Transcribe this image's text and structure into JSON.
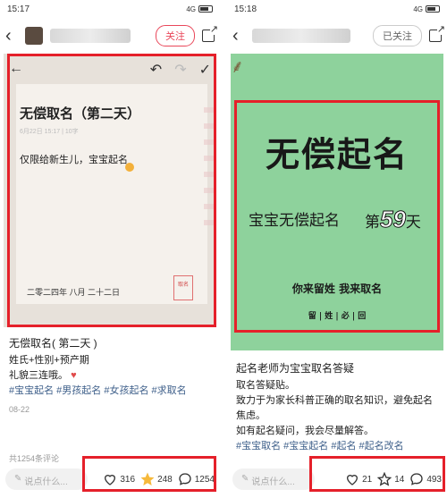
{
  "left": {
    "status": {
      "time": "15:17",
      "signal": "4G"
    },
    "header": {
      "follow_label": "关注"
    },
    "note": {
      "title": "无偿取名（第二天）",
      "meta": "6月22日 15:17  |  10字",
      "body": "仅限给新生儿，宝宝起名",
      "date": "二零二四年 八月 二十二日",
      "seal": "取名"
    },
    "post": {
      "title": "无偿取名( 第二天 )",
      "line1": "姓氏+性别+预产期",
      "line2": "礼貌三连哦。",
      "tags": "#宝宝起名 #男孩起名 #女孩起名 #求取名",
      "date": "08-22"
    },
    "comments_total": "共1254条评论",
    "bottom": {
      "placeholder": "说点什么...",
      "likes": "316",
      "stars": "248",
      "comments": "1254"
    }
  },
  "right": {
    "status": {
      "time": "15:18",
      "signal": "4G"
    },
    "header": {
      "follow_label": "已关注"
    },
    "poster": {
      "title": "无偿起名",
      "subtitle": "宝宝无偿起名",
      "day_prefix": "第",
      "day_number": "59",
      "day_suffix": "天",
      "line1": "你来留姓  我来取名",
      "line2": "留 | 姓 | 必 | 回"
    },
    "post": {
      "title": "起名老师为宝宝取名答疑",
      "line1": "取名答疑贴。",
      "line2": "致力于为家长科普正确的取名知识，避免起名焦虑。",
      "line3": "如有起名疑问，我会尽量解答。",
      "tags": "#宝宝取名 #宝宝起名 #起名 #起名改名"
    },
    "bottom": {
      "placeholder": "说点什么...",
      "likes": "21",
      "stars": "14",
      "comments": "493"
    }
  },
  "colors": {
    "accent_red": "#e5202a",
    "poster_green": "#8ed29c",
    "hashtag": "#3e5f8a"
  }
}
